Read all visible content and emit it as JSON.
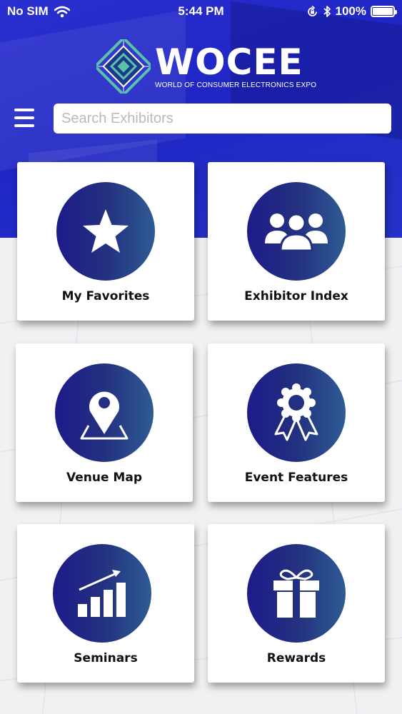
{
  "status_bar": {
    "carrier": "No SIM",
    "time": "5:44 PM",
    "battery": "100%"
  },
  "header": {
    "logo_title": "WOCEE",
    "logo_subtitle": "WORLD OF CONSUMER ELECTRONICS EXPO",
    "search_placeholder": "Search Exhibitors"
  },
  "tiles": [
    {
      "label": "My Favorites",
      "icon": "star-icon"
    },
    {
      "label": "Exhibitor Index",
      "icon": "people-icon"
    },
    {
      "label": "Venue Map",
      "icon": "map-pin-icon"
    },
    {
      "label": "Event Features",
      "icon": "award-ribbon-icon"
    },
    {
      "label": "Seminars",
      "icon": "bar-chart-growth-icon"
    },
    {
      "label": "Rewards",
      "icon": "gift-icon"
    }
  ],
  "colors": {
    "header_blue": "#2a2fd0",
    "circle_dark": "#1d1b8a",
    "circle_light": "#2e5b93"
  }
}
